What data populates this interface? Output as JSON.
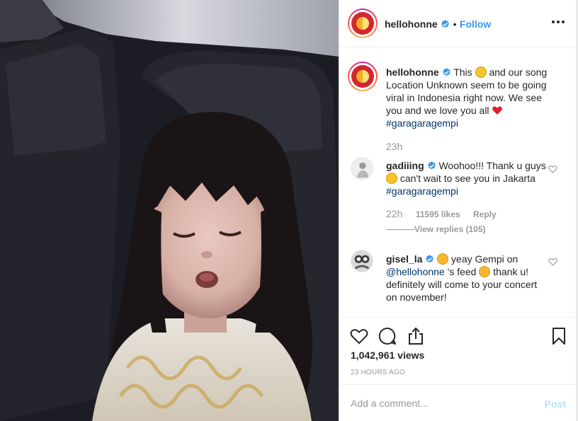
{
  "post": {
    "username": "hellohonne",
    "follow_label": "Follow",
    "separator": "•"
  },
  "caption": {
    "username": "hellohonne",
    "text_1": "This",
    "text_2": "and our song Location Unknown seem to be going viral in Indonesia right now. We see you and we love you all",
    "hashtag": "#garagaragempi",
    "time": "23h"
  },
  "comments": [
    {
      "username": "gadiiing",
      "text_1": "Woohoo!!! Thank u guys",
      "text_2": "can't wait to see you in Jakarta",
      "hashtag": "#garagaragempi",
      "time": "22h",
      "likes": "11595 likes",
      "reply_label": "Reply",
      "view_replies": "View replies (105)"
    },
    {
      "username": "gisel_la",
      "text_1": "yeay Gempi on",
      "mention": "@hellohonne",
      "text_2": "'s feed",
      "text_3": "thank u! definitely will come to your concert on november!"
    }
  ],
  "stats": {
    "views": "1,042,961 views",
    "ago": "23 HOURS AGO"
  },
  "comment_box": {
    "placeholder": "Add a comment...",
    "post_label": "Post"
  },
  "icons": {
    "verified": "verified-badge-icon",
    "more": "more-options-icon",
    "like": "heart-icon",
    "comment": "comment-bubble-icon",
    "share": "share-icon",
    "save": "bookmark-icon"
  },
  "colors": {
    "link": "#3897f0",
    "hashtag": "#003569",
    "muted": "#999999",
    "post_disabled": "#b2dffc"
  }
}
